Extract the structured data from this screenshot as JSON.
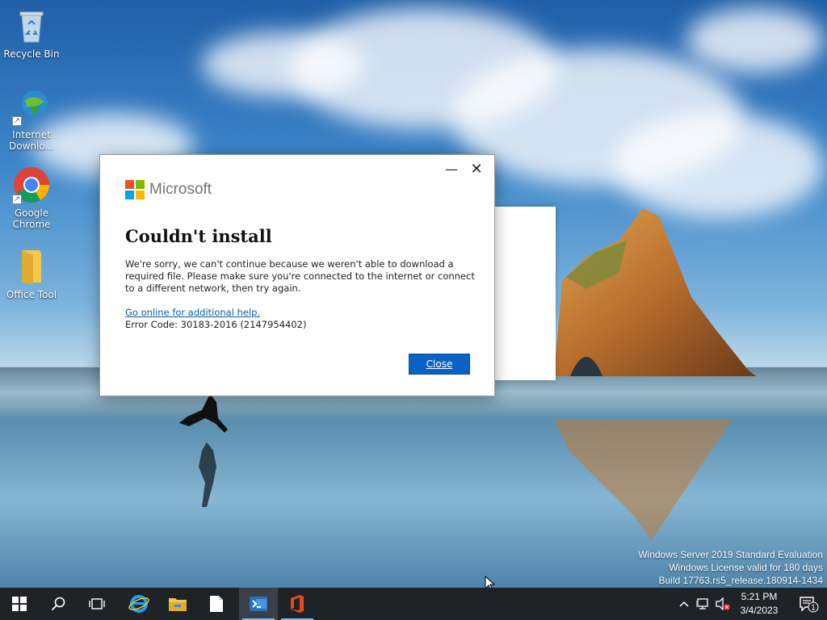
{
  "desktop": {
    "icons": [
      {
        "label": "Recycle Bin"
      },
      {
        "label": "Internet Downlo..."
      },
      {
        "label": "Google Chrome"
      },
      {
        "label": "Office Tool"
      }
    ]
  },
  "dialog": {
    "brand": "Microsoft",
    "title": "Couldn't install",
    "message": "We're sorry, we can't continue because we weren't able to download a required file.  Please make sure you're connected to the internet or connect to a different network, then try again.",
    "help_link": "Go online for additional help.",
    "error_code": "Error Code: 30183-2016 (2147954402)",
    "close_button": "Close",
    "minimize_glyph": "—",
    "close_glyph": "✕"
  },
  "watermark": {
    "line1": "Windows Server 2019 Standard Evaluation",
    "line2": "Windows License valid for 180 days",
    "line3": "Build 17763.rs5_release.180914-1434"
  },
  "taskbar": {
    "time": "5:21 PM",
    "date": "3/4/2023",
    "notification_count": "1",
    "accent": "#76b9ed"
  }
}
